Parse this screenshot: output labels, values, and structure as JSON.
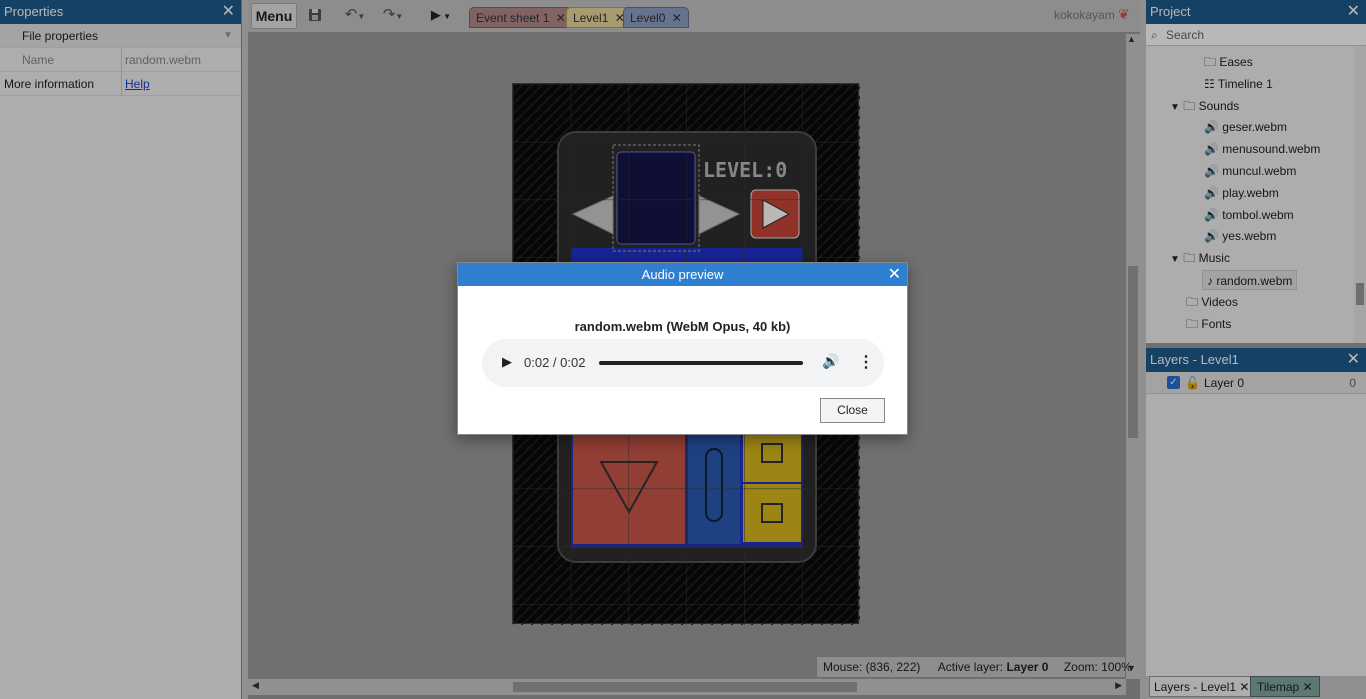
{
  "properties_panel": {
    "title": "Properties",
    "section": "File properties",
    "rows": [
      {
        "label": "Name",
        "value": "random.webm"
      }
    ],
    "more_info_label": "More information",
    "more_info_link": "Help"
  },
  "toolbar": {
    "menu_label": "Menu",
    "user": "kokokayam",
    "tabs": [
      {
        "label": "Event sheet 1"
      },
      {
        "label": "Level1"
      },
      {
        "label": "Level0"
      }
    ]
  },
  "statusbar": {
    "mouse": "Mouse: (836, 222)",
    "active_layer_label": "Active layer:",
    "active_layer": "Layer 0",
    "zoom": "Zoom: 100%"
  },
  "project_panel": {
    "title": "Project",
    "search_placeholder": "Search",
    "items": [
      {
        "label": "Eases",
        "icon": "folder-icon"
      },
      {
        "label": "Timeline 1",
        "icon": "timeline-icon"
      },
      {
        "label": "Sounds",
        "icon": "folder-icon"
      },
      {
        "label": "geser.webm",
        "icon": "speaker-icon"
      },
      {
        "label": "menusound.webm",
        "icon": "speaker-icon"
      },
      {
        "label": "muncul.webm",
        "icon": "speaker-icon"
      },
      {
        "label": "play.webm",
        "icon": "speaker-icon"
      },
      {
        "label": "tombol.webm",
        "icon": "speaker-icon"
      },
      {
        "label": "yes.webm",
        "icon": "speaker-icon"
      },
      {
        "label": "Music",
        "icon": "folder-icon"
      },
      {
        "label": "random.webm",
        "icon": "music-note-icon"
      },
      {
        "label": "Videos",
        "icon": "folder-icon"
      },
      {
        "label": "Fonts",
        "icon": "folder-icon"
      }
    ]
  },
  "layers_panel": {
    "title": "Layers - Level1",
    "layer_name": "Layer 0",
    "layer_index": "0"
  },
  "bottom_tabs": {
    "tab1": "Layers - Level1",
    "tab2": "Tilemap"
  },
  "dialog": {
    "title": "Audio preview",
    "file_info": "random.webm (WebM Opus, 40 kb)",
    "time": "0:02 / 0:02",
    "playback_progress": 1.0,
    "close_label": "Close"
  },
  "game_canvas": {
    "level_text": "LEVEL:0"
  },
  "colors": {
    "panel_title": "#1e5a8c",
    "dialog_title": "#2f7fd0",
    "tab_event": "#b58a8a",
    "tab_level1": "#e8d79a",
    "tab_level0": "#8f9fc5"
  }
}
